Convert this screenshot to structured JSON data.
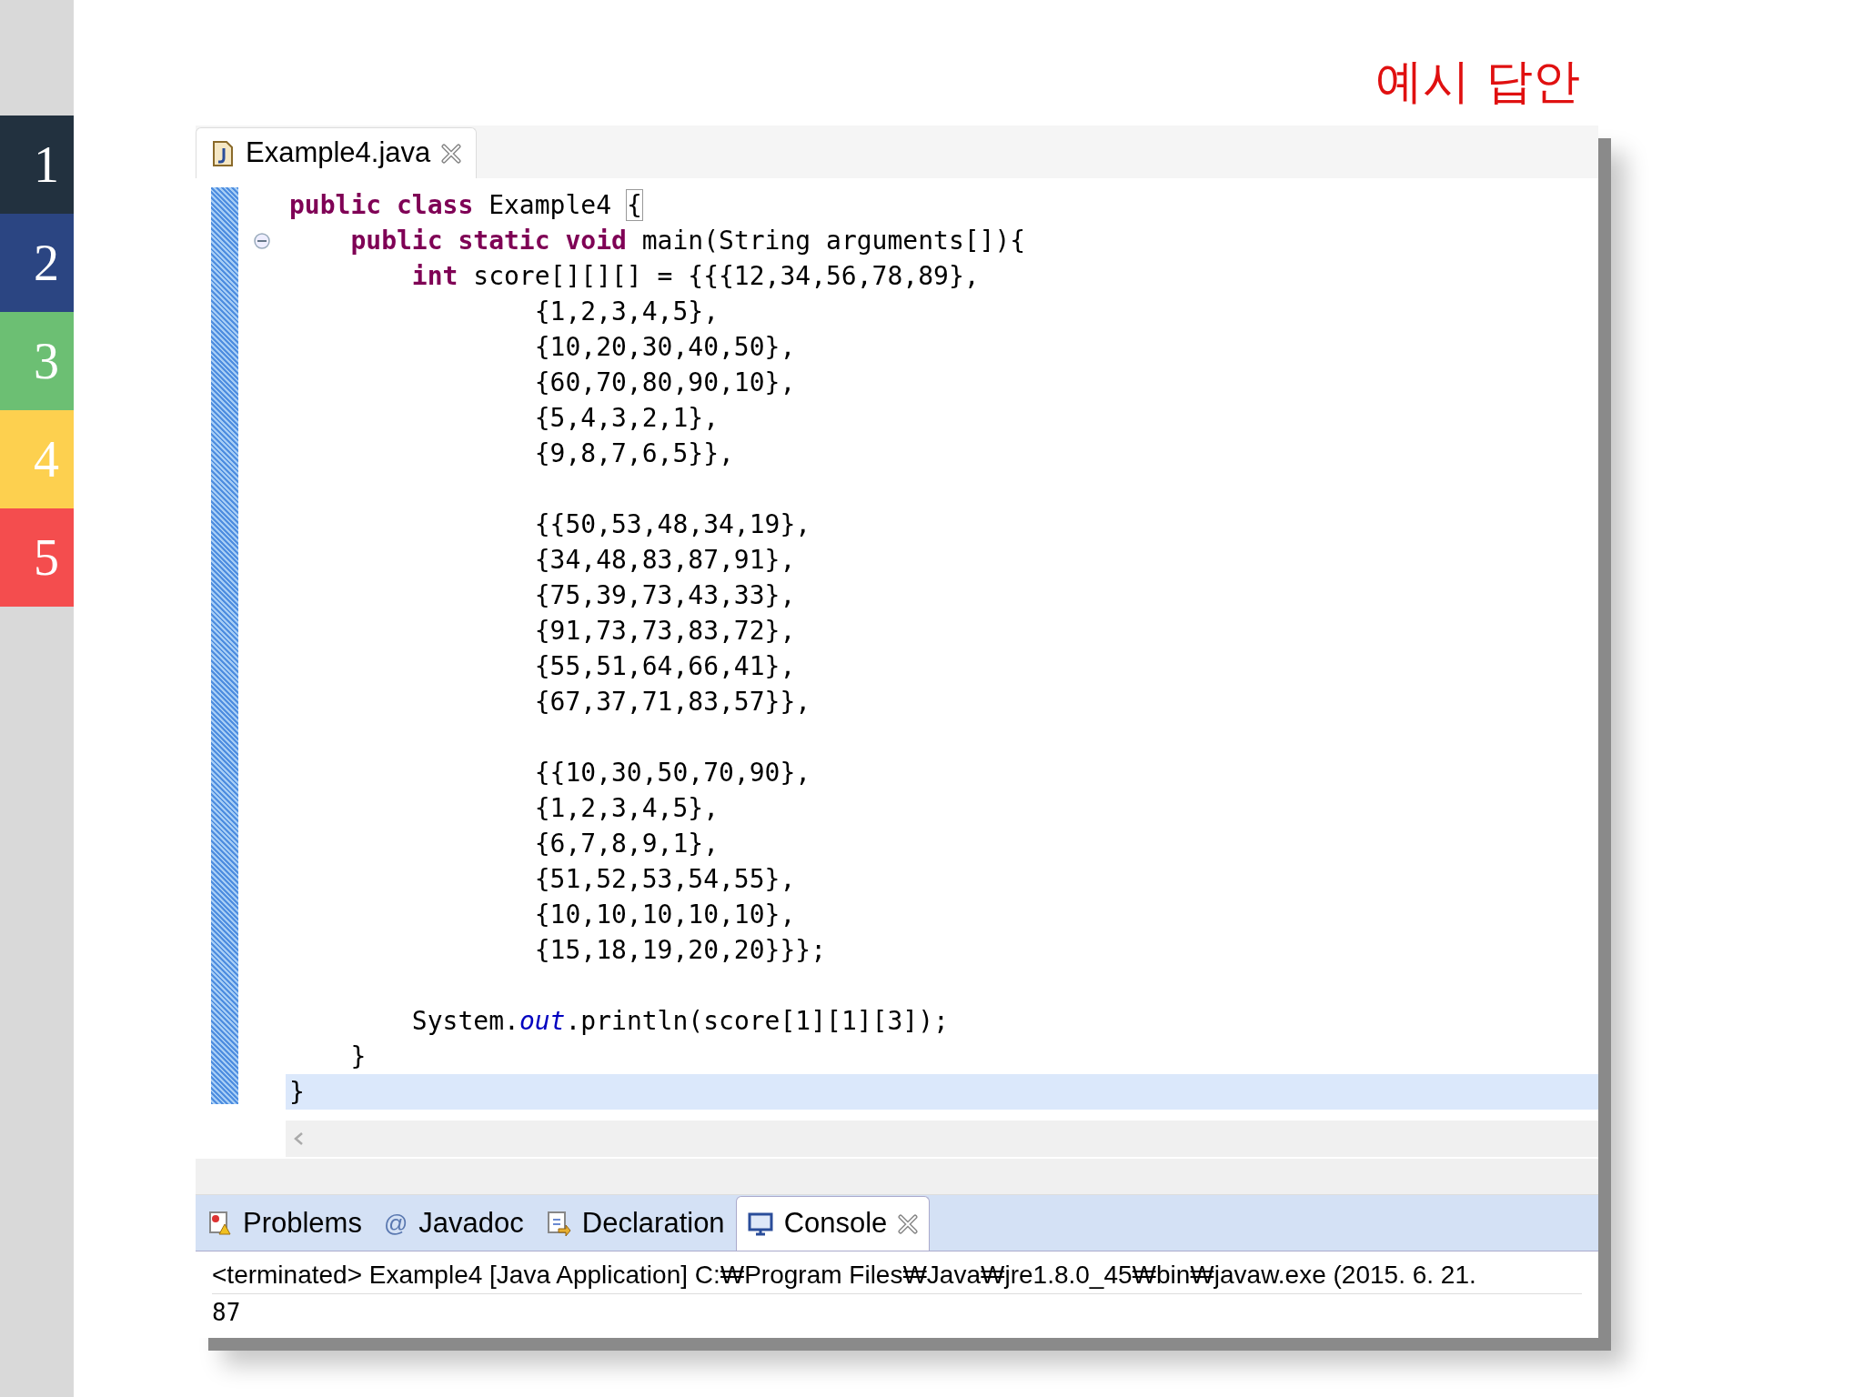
{
  "slide_nav": [
    {
      "label": "1",
      "color": "#22313f"
    },
    {
      "label": "2",
      "color": "#2b4582"
    },
    {
      "label": "3",
      "color": "#6cbf73"
    },
    {
      "label": "4",
      "color": "#fdd04f"
    },
    {
      "label": "5",
      "color": "#f44d4e"
    }
  ],
  "slide_title": "예시 답안",
  "editor": {
    "tab": {
      "label": "Example4.java",
      "selected": true
    },
    "lines": [
      {
        "fold": false,
        "highlighted": false,
        "tokens": [
          {
            "kind": "keyword",
            "text": "public class"
          },
          {
            "kind": "plain",
            "text": " Example4 "
          },
          {
            "kind": "bracket",
            "text": "{"
          }
        ]
      },
      {
        "fold": true,
        "highlighted": false,
        "tokens": [
          {
            "kind": "keyword",
            "text": "    public static void"
          },
          {
            "kind": "plain",
            "text": " main(String arguments[]){"
          }
        ]
      },
      {
        "fold": false,
        "highlighted": false,
        "tokens": [
          {
            "kind": "keyword",
            "text": "        int"
          },
          {
            "kind": "plain",
            "text": " score[][][] = {{{12,34,56,78,89},"
          }
        ]
      },
      {
        "fold": false,
        "highlighted": false,
        "tokens": [
          {
            "kind": "plain",
            "text": "                {1,2,3,4,5},"
          }
        ]
      },
      {
        "fold": false,
        "highlighted": false,
        "tokens": [
          {
            "kind": "plain",
            "text": "                {10,20,30,40,50},"
          }
        ]
      },
      {
        "fold": false,
        "highlighted": false,
        "tokens": [
          {
            "kind": "plain",
            "text": "                {60,70,80,90,10},"
          }
        ]
      },
      {
        "fold": false,
        "highlighted": false,
        "tokens": [
          {
            "kind": "plain",
            "text": "                {5,4,3,2,1},"
          }
        ]
      },
      {
        "fold": false,
        "highlighted": false,
        "tokens": [
          {
            "kind": "plain",
            "text": "                {9,8,7,6,5}},"
          }
        ]
      },
      {
        "fold": false,
        "highlighted": false
      },
      {
        "fold": false,
        "highlighted": false,
        "tokens": [
          {
            "kind": "plain",
            "text": "                {{50,53,48,34,19},"
          }
        ]
      },
      {
        "fold": false,
        "highlighted": false,
        "tokens": [
          {
            "kind": "plain",
            "text": "                {34,48,83,87,91},"
          }
        ]
      },
      {
        "fold": false,
        "highlighted": false,
        "tokens": [
          {
            "kind": "plain",
            "text": "                {75,39,73,43,33},"
          }
        ]
      },
      {
        "fold": false,
        "highlighted": false,
        "tokens": [
          {
            "kind": "plain",
            "text": "                {91,73,73,83,72},"
          }
        ]
      },
      {
        "fold": false,
        "highlighted": false,
        "tokens": [
          {
            "kind": "plain",
            "text": "                {55,51,64,66,41},"
          }
        ]
      },
      {
        "fold": false,
        "highlighted": false,
        "tokens": [
          {
            "kind": "plain",
            "text": "                {67,37,71,83,57}},"
          }
        ]
      },
      {
        "fold": false,
        "highlighted": false
      },
      {
        "fold": false,
        "highlighted": false,
        "tokens": [
          {
            "kind": "plain",
            "text": "                {{10,30,50,70,90},"
          }
        ]
      },
      {
        "fold": false,
        "highlighted": false,
        "tokens": [
          {
            "kind": "plain",
            "text": "                {1,2,3,4,5},"
          }
        ]
      },
      {
        "fold": false,
        "highlighted": false,
        "tokens": [
          {
            "kind": "plain",
            "text": "                {6,7,8,9,1},"
          }
        ]
      },
      {
        "fold": false,
        "highlighted": false,
        "tokens": [
          {
            "kind": "plain",
            "text": "                {51,52,53,54,55},"
          }
        ]
      },
      {
        "fold": false,
        "highlighted": false,
        "tokens": [
          {
            "kind": "plain",
            "text": "                {10,10,10,10,10},"
          }
        ]
      },
      {
        "fold": false,
        "highlighted": false,
        "tokens": [
          {
            "kind": "plain",
            "text": "                {15,18,19,20,20}}};"
          }
        ]
      },
      {
        "fold": false,
        "highlighted": false
      },
      {
        "fold": false,
        "highlighted": false,
        "tokens": [
          {
            "kind": "plain",
            "text": "        System."
          },
          {
            "kind": "field",
            "text": "out"
          },
          {
            "kind": "plain",
            "text": ".println(score[1][1][3]);"
          }
        ]
      },
      {
        "fold": false,
        "highlighted": false,
        "tokens": [
          {
            "kind": "plain",
            "text": "    }"
          }
        ]
      },
      {
        "fold": false,
        "highlighted": true,
        "tokens": [
          {
            "kind": "plain",
            "text": "}"
          }
        ]
      }
    ]
  },
  "bottom_panel": {
    "tabs": [
      {
        "kind": "problems",
        "label": "Problems",
        "selected": false
      },
      {
        "kind": "javadoc",
        "icon_char": "@",
        "label": "Javadoc",
        "selected": false
      },
      {
        "kind": "declaration",
        "label": "Declaration",
        "selected": false
      },
      {
        "kind": "console",
        "label": "Console",
        "selected": true
      }
    ],
    "console_header": "<terminated> Example4 [Java Application] C:₩Program Files₩Java₩jre1.8.0_45₩bin₩javaw.exe (2015. 6. 21.",
    "output": "87"
  }
}
